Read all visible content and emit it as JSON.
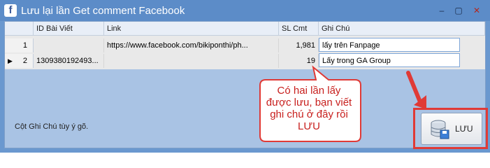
{
  "window": {
    "title": "Lưu lại lần Get comment Facebook",
    "app_icon": "facebook-icon",
    "app_icon_glyph": "f"
  },
  "controls": {
    "minimize": "–",
    "maximize": "▢",
    "close": "✕"
  },
  "grid": {
    "columns": [
      "ID Bài Viết",
      "Link",
      "SL Cmt",
      "Ghi Chú"
    ],
    "rows": [
      {
        "num": "1",
        "id": "",
        "link": "https://www.facebook.com/bikiponthi/ph...",
        "sl_cmt": "1,981",
        "ghi_chu": "lấy trên Fanpage",
        "current": false
      },
      {
        "num": "2",
        "id": "1309380192493...",
        "link": "",
        "sl_cmt": "19",
        "ghi_chu": "Lấy trong GA Group",
        "current": true
      }
    ],
    "current_row_marker": "▶"
  },
  "footer_note": "Cột Ghi Chú tùy ý gõ.",
  "callout": "Có hai lần lấy được lưu, bạn viết ghi chú ở đây rồi LƯU",
  "save_button": {
    "label": "LƯU",
    "icon": "database-save-icon"
  },
  "colors": {
    "title_bar": "#5c8cc8",
    "client": "#a9c3e4",
    "annotation_red": "#e03a36"
  }
}
